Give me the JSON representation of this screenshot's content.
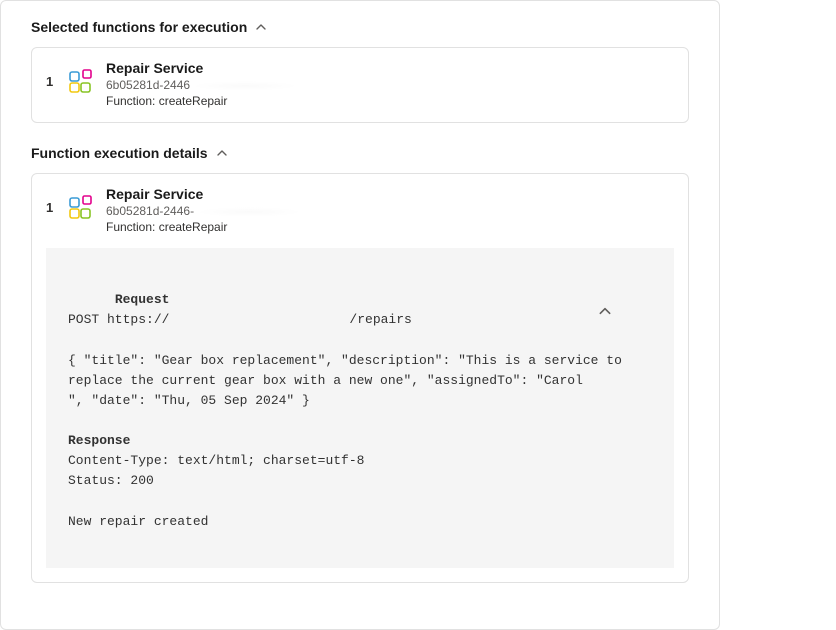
{
  "sections": {
    "selected": {
      "heading": "Selected functions for execution",
      "item": {
        "index": "1",
        "title": "Repair Service",
        "id_prefix": "6b05281d-2446",
        "function_label": "Function: createRepair"
      }
    },
    "details": {
      "heading": "Function execution details",
      "item": {
        "index": "1",
        "title": "Repair Service",
        "id_prefix": "6b05281d-2446-",
        "function_label": "Function: createRepair"
      },
      "code": {
        "request_heading": "Request",
        "method_line_prefix": "POST https://",
        "method_line_suffix": "/repairs",
        "body": "{ \"title\": \"Gear box replacement\", \"description\": \"This is a service to replace the current gear box with a new one\", \"assignedTo\": \"Carol ",
        "body_suffix": "\", \"date\": \"Thu, 05 Sep 2024\" }",
        "response_heading": "Response",
        "content_type": "Content-Type: text/html; charset=utf-8",
        "status": "Status: 200",
        "response_body": "New repair created"
      }
    }
  }
}
